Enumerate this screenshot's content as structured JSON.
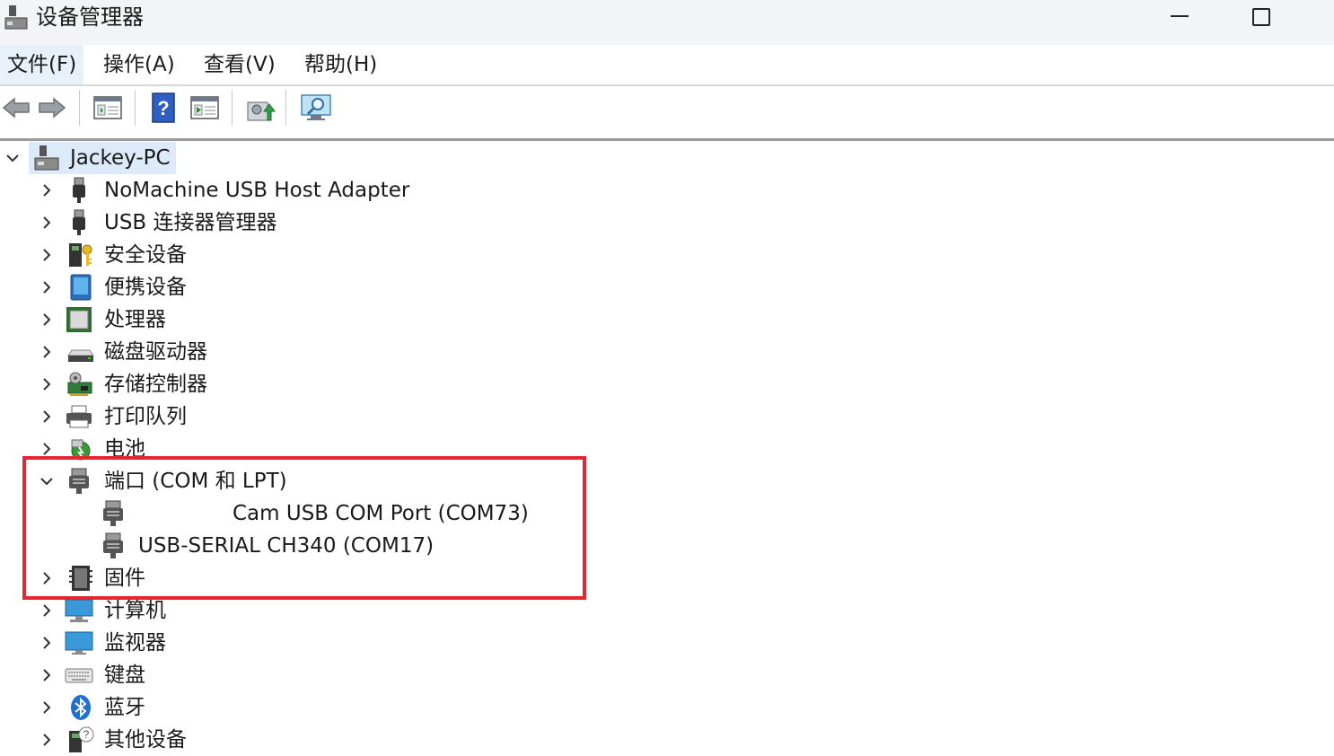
{
  "window": {
    "title": "设备管理器",
    "icon": "device-manager-icon"
  },
  "menu": [
    "文件(F)",
    "操作(A)",
    "查看(V)",
    "帮助(H)"
  ],
  "toolbar": {
    "buttons": [
      "back-arrow-icon",
      "forward-arrow-icon",
      "properties-icon",
      "help-icon",
      "run-icon",
      "update-driver-icon",
      "scan-hardware-icon"
    ]
  },
  "tree": {
    "root": "Jackey-PC",
    "items": [
      {
        "label": "NoMachine USB Host Adapter",
        "icon": "usb-icon",
        "expanded": false
      },
      {
        "label": "USB 连接器管理器",
        "icon": "usb-icon",
        "expanded": false
      },
      {
        "label": "安全设备",
        "icon": "security-device-icon",
        "expanded": false
      },
      {
        "label": "便携设备",
        "icon": "portable-device-icon",
        "expanded": false
      },
      {
        "label": "处理器",
        "icon": "processor-icon",
        "expanded": false
      },
      {
        "label": "磁盘驱动器",
        "icon": "disk-drive-icon",
        "expanded": false
      },
      {
        "label": "存储控制器",
        "icon": "storage-controller-icon",
        "expanded": false
      },
      {
        "label": "打印队列",
        "icon": "printer-icon",
        "expanded": false
      },
      {
        "label": "电池",
        "icon": "battery-icon",
        "expanded": false
      },
      {
        "label": "端口 (COM 和 LPT)",
        "icon": "port-icon",
        "expanded": true,
        "children": [
          {
            "label": "Cam USB COM Port (COM73)",
            "icon": "port-icon"
          },
          {
            "label": "USB-SERIAL CH340 (COM17)",
            "icon": "port-icon"
          }
        ]
      },
      {
        "label": "固件",
        "icon": "firmware-icon",
        "expanded": false
      },
      {
        "label": "计算机",
        "icon": "computer-icon",
        "expanded": false
      },
      {
        "label": "监视器",
        "icon": "monitor-icon",
        "expanded": false
      },
      {
        "label": "键盘",
        "icon": "keyboard-icon",
        "expanded": false
      },
      {
        "label": "蓝牙",
        "icon": "bluetooth-icon",
        "expanded": false
      },
      {
        "label": "其他设备",
        "icon": "other-device-icon",
        "expanded": false
      }
    ]
  },
  "colors": {
    "titlebar_bg": "#f3f4f8",
    "selection_bg": "#dceaf9",
    "annotation_red": "#e6262e"
  }
}
